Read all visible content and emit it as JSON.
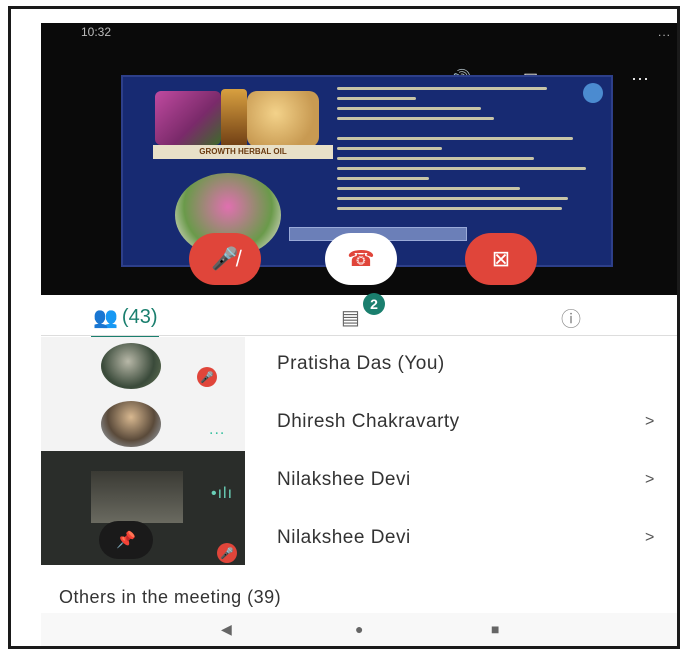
{
  "status_bar": {
    "time": "10:32",
    "icons": "..."
  },
  "video": {
    "speaker_icon": "volume-icon",
    "layout_icon": "layout-icon",
    "more_icon": "more-vert-icon",
    "slide_caption": "GROWTH HERBAL OIL",
    "mute_icon": "mic-off-icon",
    "end_icon": "end-call-icon",
    "camera_icon": "videocam-off-icon"
  },
  "tabs": {
    "people_label": "(43)",
    "chat_badge": "2",
    "accent_color": "#1a7f6e"
  },
  "participants": [
    {
      "name": "Pratisha Das (You)",
      "muted": true
    },
    {
      "name": "Dhiresh Chakravarty",
      "chevron": ">",
      "speaking": "..."
    },
    {
      "name": "Nilakshee Devi",
      "chevron": ">",
      "speaking": "•ılı"
    },
    {
      "name": "Nilakshee Devi",
      "chevron": ">",
      "muted": true
    }
  ],
  "others": {
    "label": "Others in the meeting (39)"
  },
  "navbar": {
    "back": "◀",
    "home": "●",
    "recents": "■"
  },
  "colors": {
    "mute_red": "#e0453a",
    "slide_blue": "#172a72"
  }
}
